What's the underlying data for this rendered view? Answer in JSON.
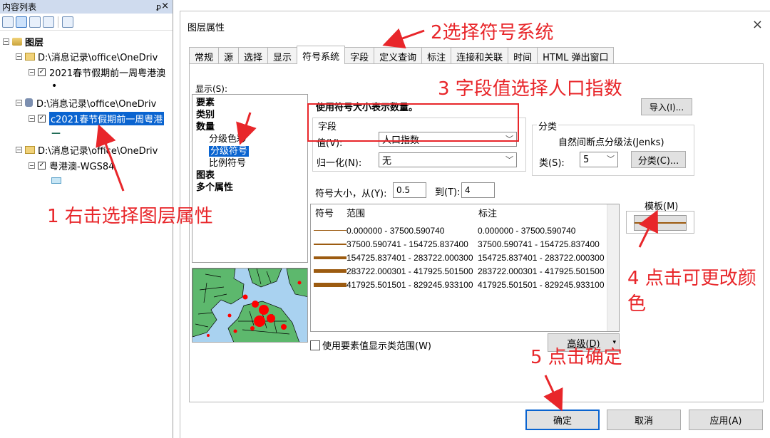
{
  "toc": {
    "title": "内容列表",
    "pin": "ꝑ",
    "close": "×",
    "root_label": "图层",
    "items": [
      {
        "path": "D:\\消息记录\\office\\OneDriv",
        "layer": "2021春节假期前一周粤港澳",
        "symbol": "•"
      },
      {
        "path": "D:\\消息记录\\office\\OneDriv",
        "layer": "c2021春节假期前一周粤港",
        "symbol": "—"
      },
      {
        "path": "D:\\消息记录\\office\\OneDriv",
        "layer": "粤港澳-WGS84",
        "symbol": ""
      }
    ]
  },
  "dialog": {
    "title": "图层属性",
    "close": "×",
    "tabs": [
      "常规",
      "源",
      "选择",
      "显示",
      "符号系统",
      "字段",
      "定义查询",
      "标注",
      "连接和关联",
      "时间",
      "HTML 弹出窗口"
    ],
    "active_tab": "符号系统",
    "show_label": "显示(S):",
    "show_list": [
      {
        "label": "要素",
        "bold": true
      },
      {
        "label": "类别",
        "bold": true
      },
      {
        "label": "数量",
        "bold": true
      },
      {
        "label": "分级色彩",
        "sub": true
      },
      {
        "label": "分级符号",
        "sub": true,
        "selected": true
      },
      {
        "label": "比例符号",
        "sub": true
      },
      {
        "label": "图表",
        "bold": true
      },
      {
        "label": "多个属性",
        "bold": true
      }
    ],
    "heading": "使用符号大小表示数量。",
    "import_button": "导入(I)...",
    "field_group": "字段",
    "value_label": "值(V):",
    "value_selected": "人口指数",
    "normalize_label": "归一化(N):",
    "normalize_selected": "无",
    "class_group": "分类",
    "class_method": "自然间断点分级法(Jenks)",
    "classes_label": "类(S):",
    "classes_value": "5",
    "classify_button": "分类(C)...",
    "size_from_label": "符号大小，从(Y):",
    "size_from": "0.5",
    "size_to_label": "到(T):",
    "size_to": "4",
    "table_headers": {
      "symbol": "符号",
      "range": "范围",
      "label": "标注"
    },
    "classes": [
      {
        "range": "0.000000 - 37500.590740",
        "label": "0.000000 - 37500.590740",
        "stroke": 1
      },
      {
        "range": "37500.590741 - 154725.837400",
        "label": "37500.590741 - 154725.837400",
        "stroke": 2
      },
      {
        "range": "154725.837401 - 283722.000300",
        "label": "154725.837401 - 283722.000300",
        "stroke": 4
      },
      {
        "range": "283722.000301 - 417925.501500",
        "label": "283722.000301 - 417925.501500",
        "stroke": 5
      },
      {
        "range": "417925.501501 - 829245.933100",
        "label": "417925.501501 - 829245.933100",
        "stroke": 6
      }
    ],
    "template_label": "模板(M)",
    "use_feature_values": "使用要素值显示类范围(W)",
    "advanced_button": "高级(D)",
    "ok_button": "确定",
    "cancel_button": "取消",
    "apply_button": "应用(A)"
  },
  "annotations": {
    "step1": "1 右击选择图层属性",
    "step2": "2选择符号系统",
    "step3": "3 字段值选择人口指数",
    "step4_line1": "4 点击可更改颜",
    "step4_line2": "色",
    "step5": "5 点击确定"
  },
  "colors": {
    "annotation": "#e8262a",
    "symbol": "#9c5b10",
    "selection": "#0a64d0",
    "map_land": "#5db86d",
    "map_water": "#a9d2f0",
    "map_dot": "#ff0000"
  }
}
